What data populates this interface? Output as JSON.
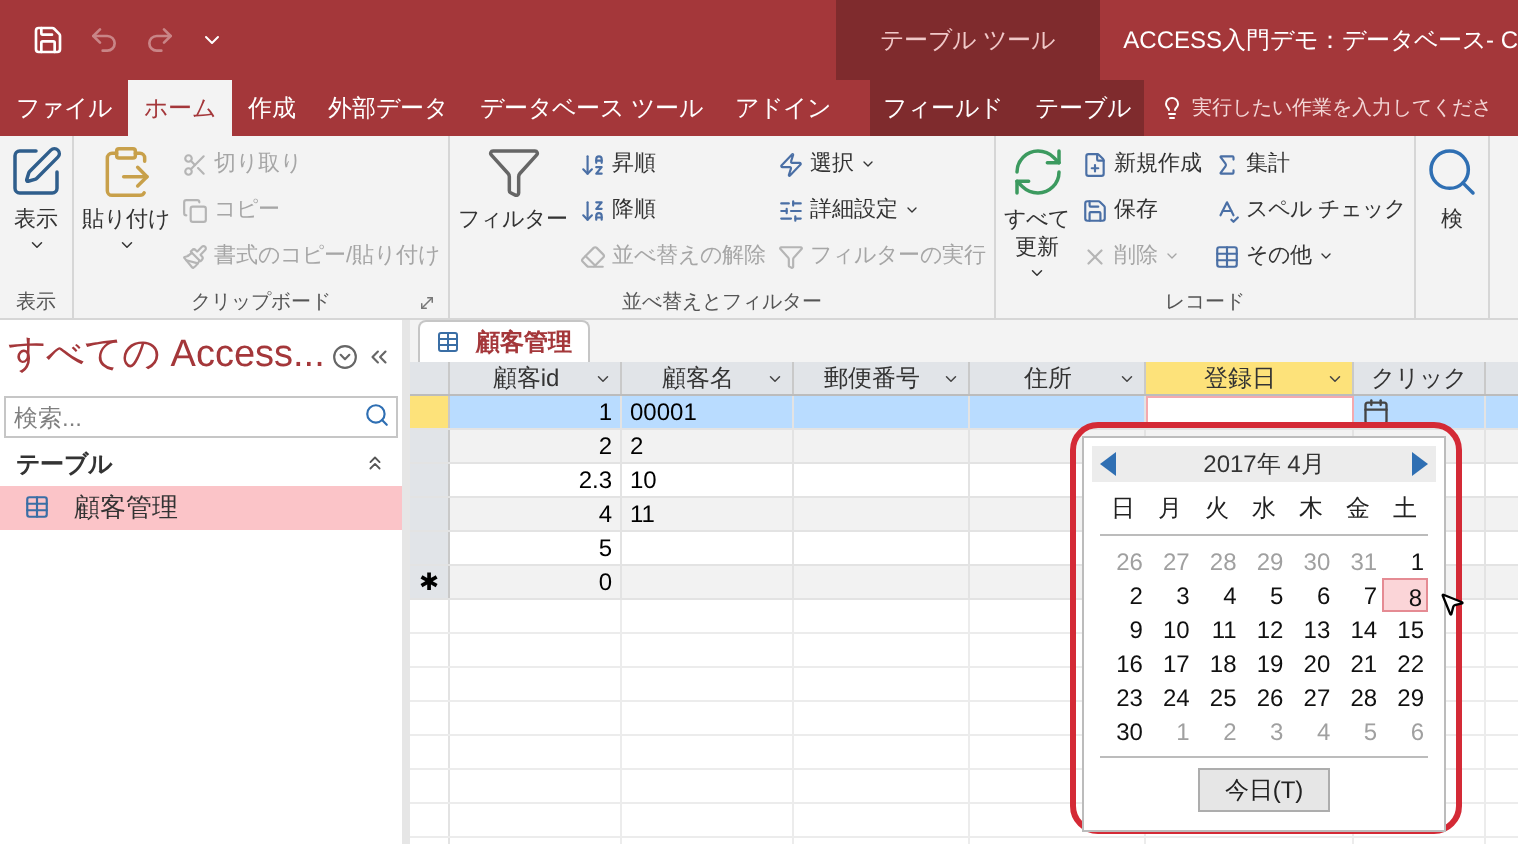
{
  "title_bar": {
    "context_label": "テーブル ツール",
    "title": "ACCESS入門デモ：データベース- C"
  },
  "ribbon_tabs": [
    {
      "label": "ファイル",
      "selected": false,
      "kind": "normal"
    },
    {
      "label": "ホーム",
      "selected": true,
      "kind": "normal"
    },
    {
      "label": "作成",
      "selected": false,
      "kind": "normal"
    },
    {
      "label": "外部データ",
      "selected": false,
      "kind": "normal"
    },
    {
      "label": "データベース ツール",
      "selected": false,
      "kind": "normal"
    },
    {
      "label": "アドイン",
      "selected": false,
      "kind": "normal"
    },
    {
      "label": "フィールド",
      "selected": false,
      "kind": "contextual"
    },
    {
      "label": "テーブル",
      "selected": false,
      "kind": "contextual"
    }
  ],
  "tell_me": {
    "placeholder": "実行したい作業を入力してくださ"
  },
  "ribbon_groups": [
    {
      "label": "表示",
      "large": [
        {
          "lines": [
            "表示"
          ],
          "dropdown": true
        }
      ]
    },
    {
      "label": "クリップボード",
      "launcher": true,
      "large": [
        {
          "lines": [
            "貼り付け"
          ],
          "dropdown": true
        }
      ],
      "columns": [
        [
          {
            "label": "切り取り",
            "disabled": true,
            "dropdown": false
          },
          {
            "label": "コピー",
            "disabled": true,
            "dropdown": false
          },
          {
            "label": "書式のコピー/貼り付け",
            "disabled": true,
            "dropdown": false
          }
        ]
      ]
    },
    {
      "label": "並べ替えとフィルター",
      "large": [
        {
          "lines": [
            "フィルター"
          ],
          "dropdown": false
        }
      ],
      "columns": [
        [
          {
            "label": "昇順",
            "disabled": false,
            "dropdown": false
          },
          {
            "label": "降順",
            "disabled": false,
            "dropdown": false
          },
          {
            "label": "並べ替えの解除",
            "disabled": true,
            "dropdown": false
          }
        ],
        [
          {
            "label": "選択",
            "disabled": false,
            "dropdown": true
          },
          {
            "label": "詳細設定",
            "disabled": false,
            "dropdown": true
          },
          {
            "label": "フィルターの実行",
            "disabled": true,
            "dropdown": false
          }
        ]
      ]
    },
    {
      "label": "レコード",
      "large": [
        {
          "lines": [
            "すべて",
            "更新"
          ],
          "dropdown": true
        }
      ],
      "columns": [
        [
          {
            "label": "新規作成",
            "disabled": false,
            "dropdown": false
          },
          {
            "label": "保存",
            "disabled": false,
            "dropdown": false
          },
          {
            "label": "削除",
            "disabled": true,
            "dropdown": true
          }
        ],
        [
          {
            "label": "集計",
            "disabled": false,
            "dropdown": false
          },
          {
            "label": "スペル チェック",
            "disabled": false,
            "dropdown": false
          },
          {
            "label": "その他",
            "disabled": false,
            "dropdown": true
          }
        ]
      ]
    },
    {
      "large": [
        {
          "lines": [
            "検"
          ],
          "dropdown": false
        }
      ]
    }
  ],
  "nav_pane": {
    "title": "すべての Access...",
    "search": {
      "placeholder": "検索..."
    },
    "sections": [
      {
        "label": "テーブル",
        "expanded": true,
        "items": [
          {
            "label": "顧客管理",
            "selected": true
          }
        ]
      }
    ]
  },
  "document_tab": {
    "label": "顧客管理"
  },
  "table": {
    "columns": [
      {
        "label": "顧客id",
        "kind": "number",
        "selected": false
      },
      {
        "label": "顧客名",
        "kind": "text",
        "selected": false
      },
      {
        "label": "郵便番号",
        "kind": "text",
        "selected": false
      },
      {
        "label": "住所",
        "kind": "text",
        "selected": false
      },
      {
        "label": "登録日",
        "kind": "date",
        "selected": true
      },
      {
        "label": "クリック",
        "kind": "text",
        "selected": false
      }
    ],
    "rows": [
      {
        "kind": "record",
        "selected": true,
        "cells": [
          "1",
          "00001",
          "",
          "",
          "",
          ""
        ]
      },
      {
        "kind": "record",
        "selected": false,
        "cells": [
          "2",
          "2",
          "",
          "",
          "",
          ""
        ]
      },
      {
        "kind": "record",
        "selected": false,
        "cells": [
          "2.3",
          "10",
          "",
          "",
          "",
          ""
        ]
      },
      {
        "kind": "record",
        "selected": false,
        "cells": [
          "4",
          "11",
          "",
          "",
          "",
          ""
        ]
      },
      {
        "kind": "record",
        "selected": false,
        "cells": [
          "5",
          "",
          "",
          "",
          "",
          ""
        ]
      },
      {
        "kind": "new",
        "selected": false,
        "selector": "✱",
        "cells": [
          "0",
          "",
          "",
          "",
          "",
          ""
        ]
      }
    ]
  },
  "date_picker": {
    "month_label": "2017年 4月",
    "weekdays": [
      "日",
      "月",
      "火",
      "水",
      "木",
      "金",
      "土"
    ],
    "weeks": [
      [
        {
          "day": "26",
          "kind": "other",
          "selected": false
        },
        {
          "day": "27",
          "kind": "other",
          "selected": false
        },
        {
          "day": "28",
          "kind": "other",
          "selected": false
        },
        {
          "day": "29",
          "kind": "other",
          "selected": false
        },
        {
          "day": "30",
          "kind": "other",
          "selected": false
        },
        {
          "day": "31",
          "kind": "other",
          "selected": false
        },
        {
          "day": "1",
          "kind": "current",
          "selected": false
        }
      ],
      [
        {
          "day": "2",
          "kind": "current",
          "selected": false
        },
        {
          "day": "3",
          "kind": "current",
          "selected": false
        },
        {
          "day": "4",
          "kind": "current",
          "selected": false
        },
        {
          "day": "5",
          "kind": "current",
          "selected": false
        },
        {
          "day": "6",
          "kind": "current",
          "selected": false
        },
        {
          "day": "7",
          "kind": "current",
          "selected": false
        },
        {
          "day": "8",
          "kind": "current",
          "selected": true
        }
      ],
      [
        {
          "day": "9",
          "kind": "current",
          "selected": false
        },
        {
          "day": "10",
          "kind": "current",
          "selected": false
        },
        {
          "day": "11",
          "kind": "current",
          "selected": false
        },
        {
          "day": "12",
          "kind": "current",
          "selected": false
        },
        {
          "day": "13",
          "kind": "current",
          "selected": false
        },
        {
          "day": "14",
          "kind": "current",
          "selected": false
        },
        {
          "day": "15",
          "kind": "current",
          "selected": false
        }
      ],
      [
        {
          "day": "16",
          "kind": "current",
          "selected": false
        },
        {
          "day": "17",
          "kind": "current",
          "selected": false
        },
        {
          "day": "18",
          "kind": "current",
          "selected": false
        },
        {
          "day": "19",
          "kind": "current",
          "selected": false
        },
        {
          "day": "20",
          "kind": "current",
          "selected": false
        },
        {
          "day": "21",
          "kind": "current",
          "selected": false
        },
        {
          "day": "22",
          "kind": "current",
          "selected": false
        }
      ],
      [
        {
          "day": "23",
          "kind": "current",
          "selected": false
        },
        {
          "day": "24",
          "kind": "current",
          "selected": false
        },
        {
          "day": "25",
          "kind": "current",
          "selected": false
        },
        {
          "day": "26",
          "kind": "current",
          "selected": false
        },
        {
          "day": "27",
          "kind": "current",
          "selected": false
        },
        {
          "day": "28",
          "kind": "current",
          "selected": false
        },
        {
          "day": "29",
          "kind": "current",
          "selected": false
        }
      ],
      [
        {
          "day": "30",
          "kind": "current",
          "selected": false
        },
        {
          "day": "1",
          "kind": "other",
          "selected": false
        },
        {
          "day": "2",
          "kind": "other",
          "selected": false
        },
        {
          "day": "3",
          "kind": "other",
          "selected": false
        },
        {
          "day": "4",
          "kind": "other",
          "selected": false
        },
        {
          "day": "5",
          "kind": "other",
          "selected": false
        },
        {
          "day": "6",
          "kind": "other",
          "selected": false
        }
      ]
    ],
    "today_button": "今日(T)"
  }
}
